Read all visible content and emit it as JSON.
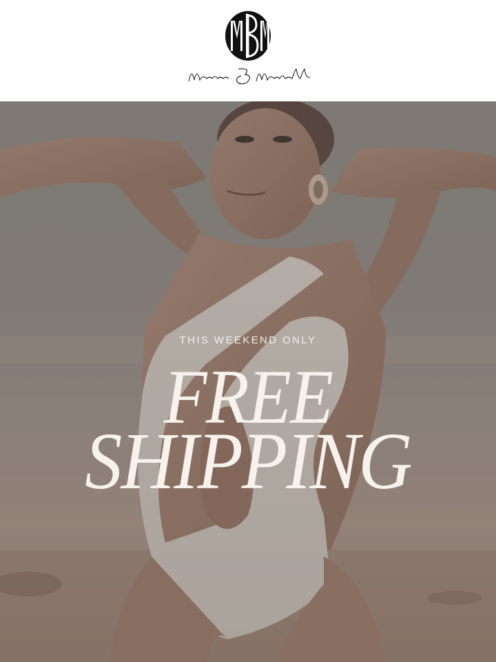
{
  "brand": {
    "monogram": "MBM",
    "script_name": "Marcia B Maxwell"
  },
  "hero": {
    "eyebrow": "THIS WEEKEND ONLY",
    "headline_line1": "FREE",
    "headline_line2": "SHIPPING"
  },
  "colors": {
    "background": "#ffffff",
    "logo": "#111111",
    "hero_text": "#f7f2ec",
    "sky": "#8f8a84",
    "sand": "#a8968a"
  }
}
